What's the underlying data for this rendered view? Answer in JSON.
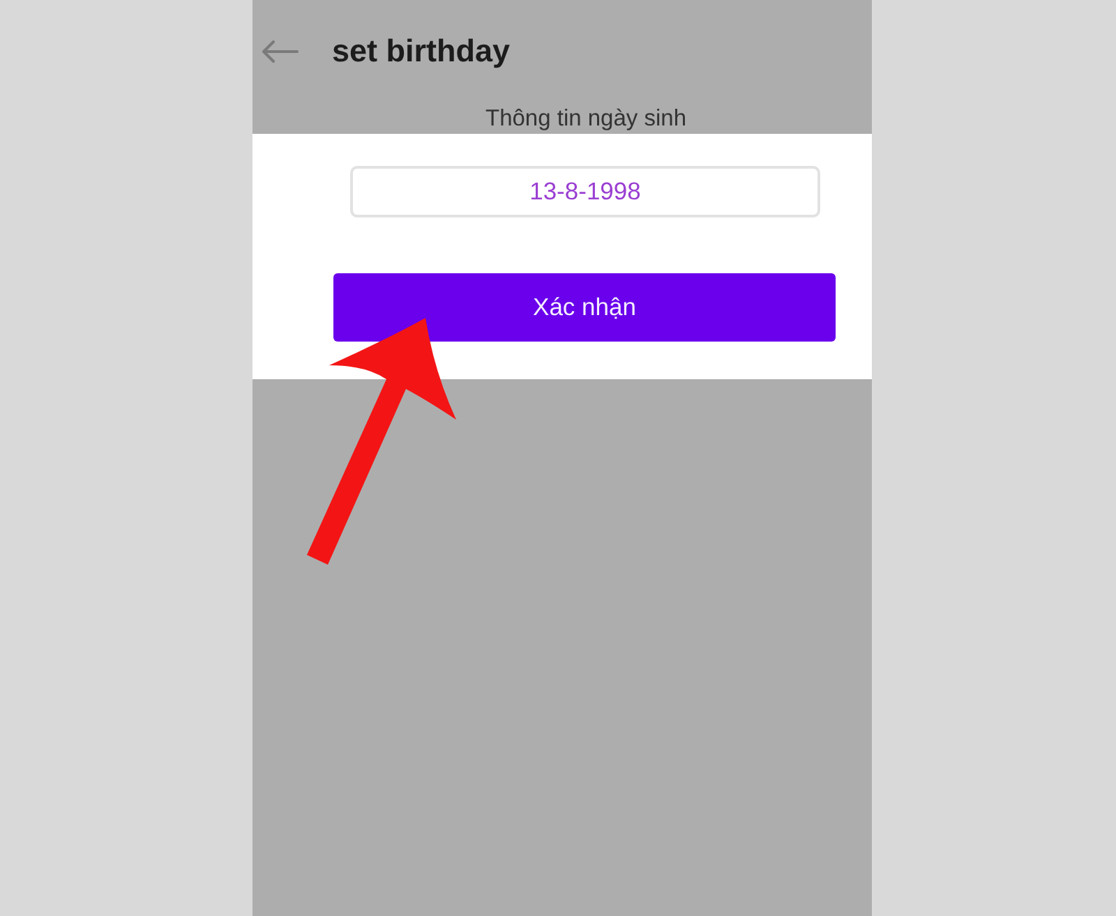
{
  "header": {
    "title": "set birthday"
  },
  "section_label": "Thông tin ngày sinh",
  "birthday_field": {
    "value": "13-8-1998"
  },
  "confirm_button": {
    "label": "Xác nhận"
  }
}
